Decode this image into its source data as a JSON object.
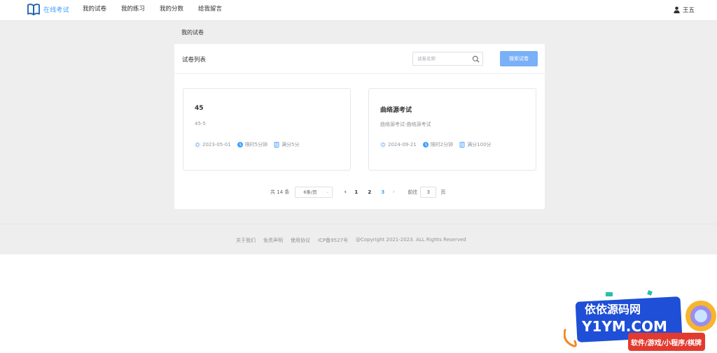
{
  "header": {
    "logo_text": "在线考试",
    "nav": [
      "我的试卷",
      "我的练习",
      "我的分数",
      "给我留言"
    ],
    "user_name": "王五"
  },
  "breadcrumb": "我的试卷",
  "panel": {
    "title": "试卷列表",
    "search_placeholder": "试卷名称",
    "search_button": "搜索试卷"
  },
  "papers": [
    {
      "title": "45",
      "desc": "45-5",
      "date": "2023-05-01",
      "time_limit": "限时5分钟",
      "full_score": "满分5分"
    },
    {
      "title": "曲络源考试",
      "desc": "曲络源考试-曲络源考试",
      "date": "2024-09-21",
      "time_limit": "限时2分钟",
      "full_score": "满分100分"
    }
  ],
  "pagination": {
    "total": "共 14 条",
    "page_size": "6条/页",
    "pages": [
      "1",
      "2",
      "3"
    ],
    "current": "3",
    "goto_label": "前往",
    "goto_value": "3",
    "page_suffix": "页"
  },
  "footer": {
    "links": [
      "关于我们",
      "免责声明",
      "使用协议",
      "ICP备9527号"
    ],
    "copyright": "@Copyright 2021-2023. ALL Rights Reserved"
  },
  "watermark": {
    "line1": "依依源码网",
    "line2": "Y1YM.COM",
    "line3": "软件/游戏/小程序/棋牌"
  },
  "colors": {
    "primary": "#409eff",
    "button": "#79b0f8",
    "background": "#eeeeee"
  }
}
